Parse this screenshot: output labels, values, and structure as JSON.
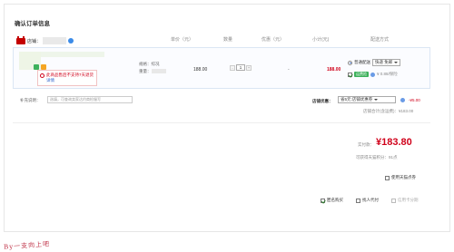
{
  "title": "确认订单信息",
  "shop": {
    "label": "店铺："
  },
  "columns": {
    "price": "单价（元）",
    "quantity": "数量",
    "discount": "优惠（元）",
    "subtotal": "小计(元)",
    "shipping": "配送方式"
  },
  "item": {
    "notice_text": "此商品售后不支持7天退货",
    "notice_link": "详情",
    "spec_label": "规格：",
    "spec_value": "综况",
    "weight_label": "重量：",
    "price": "188.00",
    "quantity": "1",
    "qty_minus": "-",
    "qty_plus": "+",
    "discount": "-",
    "subtotal": "188.00"
  },
  "shipping": {
    "option_label": "普通配送",
    "selected": "快递 免邮",
    "freight_badge": "运费险",
    "freight_price": "¥ 0.88/保险"
  },
  "message": {
    "label": "补充说明：",
    "placeholder": "选填，可查询卖家达约商检服写"
  },
  "coupon": {
    "label": "店铺优惠：",
    "selected": "省5元:店铺优惠券",
    "amount": "-¥5.00"
  },
  "shop_total": "店铺合计(含运费)：¥183.00",
  "payment": {
    "label": "实付款：",
    "amount": "¥183.80",
    "points": "可获得天猫积分：91点"
  },
  "options": {
    "tmall_card": "使用天猫点券",
    "anonymous": "匿名购买",
    "proxy_pay": "找人代付",
    "credit_installment": "信用卡分期"
  },
  "watermark": "By一支向上吧",
  "colors": {
    "accent_red": "#d0021b",
    "tmall_red": "#c40000",
    "link_blue": "#3366cc",
    "green": "#3db15b"
  },
  "icons": [
    "tmall-logo-icon",
    "info-icon",
    "warning-icon",
    "radio-icon",
    "checkbox-icon",
    "chevron-down-icon",
    "question-icon"
  ]
}
